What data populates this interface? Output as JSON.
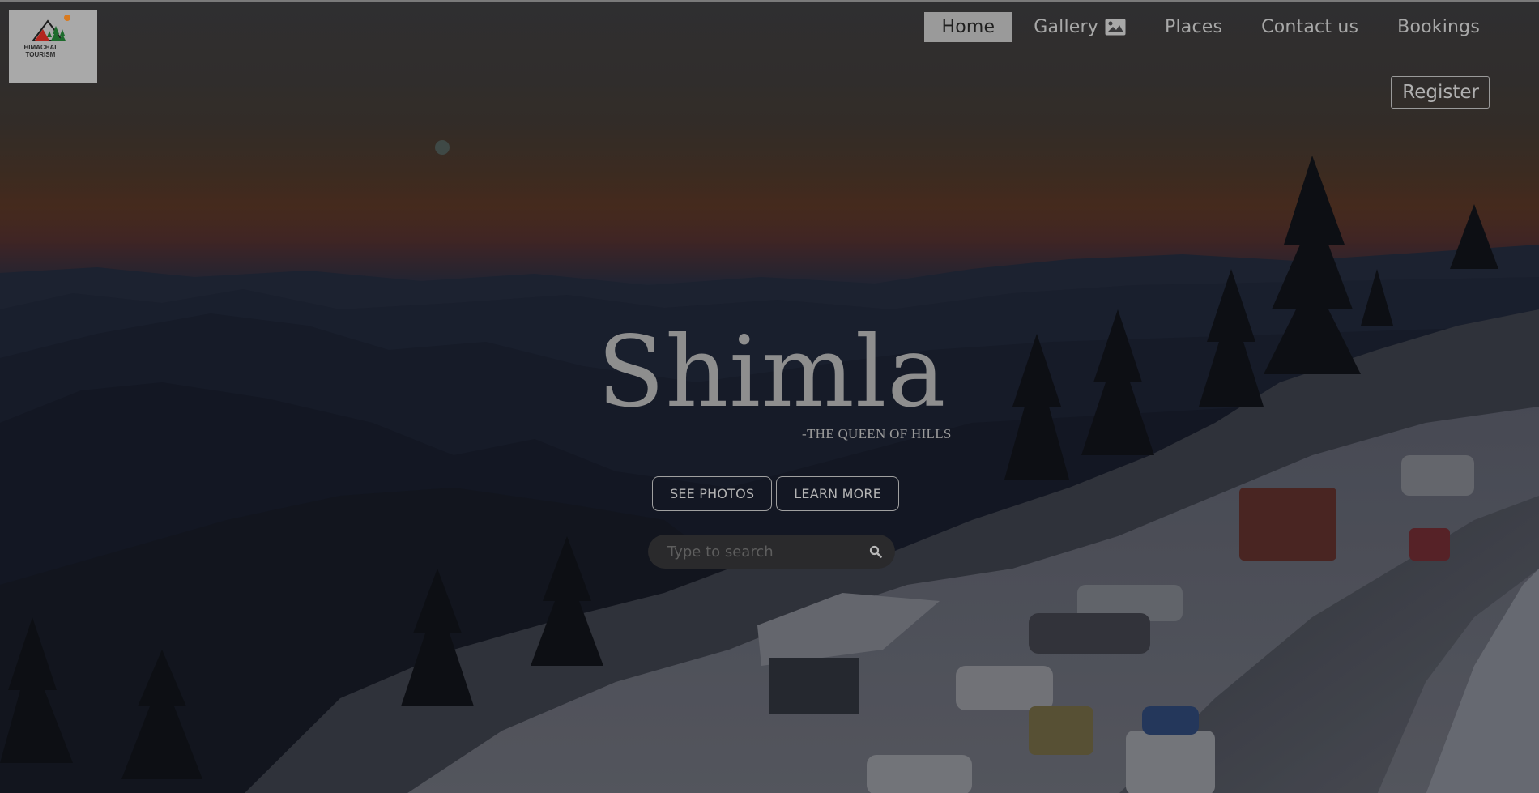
{
  "logo": {
    "text_line1": "HIMACHAL",
    "text_line2": "TOURISM"
  },
  "nav": {
    "items": [
      {
        "label": "Home",
        "active": true
      },
      {
        "label": "Gallery",
        "icon": "image-icon"
      },
      {
        "label": "Places"
      },
      {
        "label": "Contact us"
      },
      {
        "label": "Bookings"
      }
    ],
    "register_label": "Register"
  },
  "hero": {
    "title": "Shimla",
    "subtitle": "-THE QUEEN OF HILLS",
    "buttons": {
      "see_photos": "SEE PHOTOS",
      "learn_more": "LEARN MORE"
    }
  },
  "search": {
    "placeholder": "Type to search",
    "value": "",
    "icon": "search-icon"
  },
  "colors": {
    "active_nav_bg": "#9a9a9a",
    "text_muted": "#a8a8a8"
  }
}
